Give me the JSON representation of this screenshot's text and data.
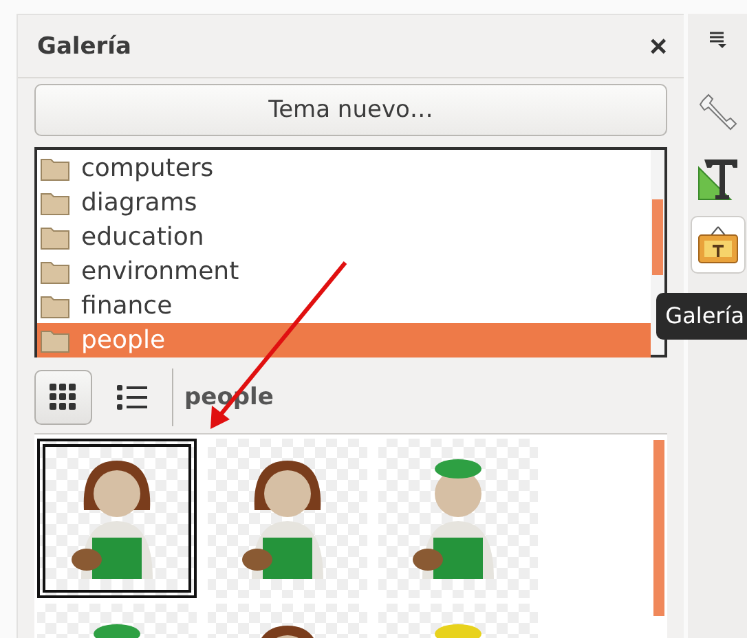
{
  "panel": {
    "title": "Galería",
    "close": "×"
  },
  "new_theme_button": "Tema nuevo…",
  "themes": [
    {
      "label": "computers",
      "selected": false
    },
    {
      "label": "diagrams",
      "selected": false
    },
    {
      "label": "education",
      "selected": false
    },
    {
      "label": "environment",
      "selected": false
    },
    {
      "label": "finance",
      "selected": false
    },
    {
      "label": "people",
      "selected": true
    }
  ],
  "view_buttons": [
    {
      "kind": "icons",
      "selected": true
    },
    {
      "kind": "details",
      "selected": false
    }
  ],
  "current_theme": "people",
  "items": [
    {
      "kind": "hair",
      "selected": true
    },
    {
      "kind": "hair",
      "selected": false
    },
    {
      "kind": "beret",
      "selected": false
    },
    {
      "kind": "beret",
      "selected": false
    },
    {
      "kind": "hair",
      "selected": false
    },
    {
      "kind": "hat",
      "selected": false
    }
  ],
  "deck_tabs": [
    {
      "kind": "properties",
      "selected": false
    },
    {
      "kind": "styles",
      "selected": false
    },
    {
      "kind": "gallery",
      "selected": true
    }
  ],
  "tooltip": "Galería"
}
